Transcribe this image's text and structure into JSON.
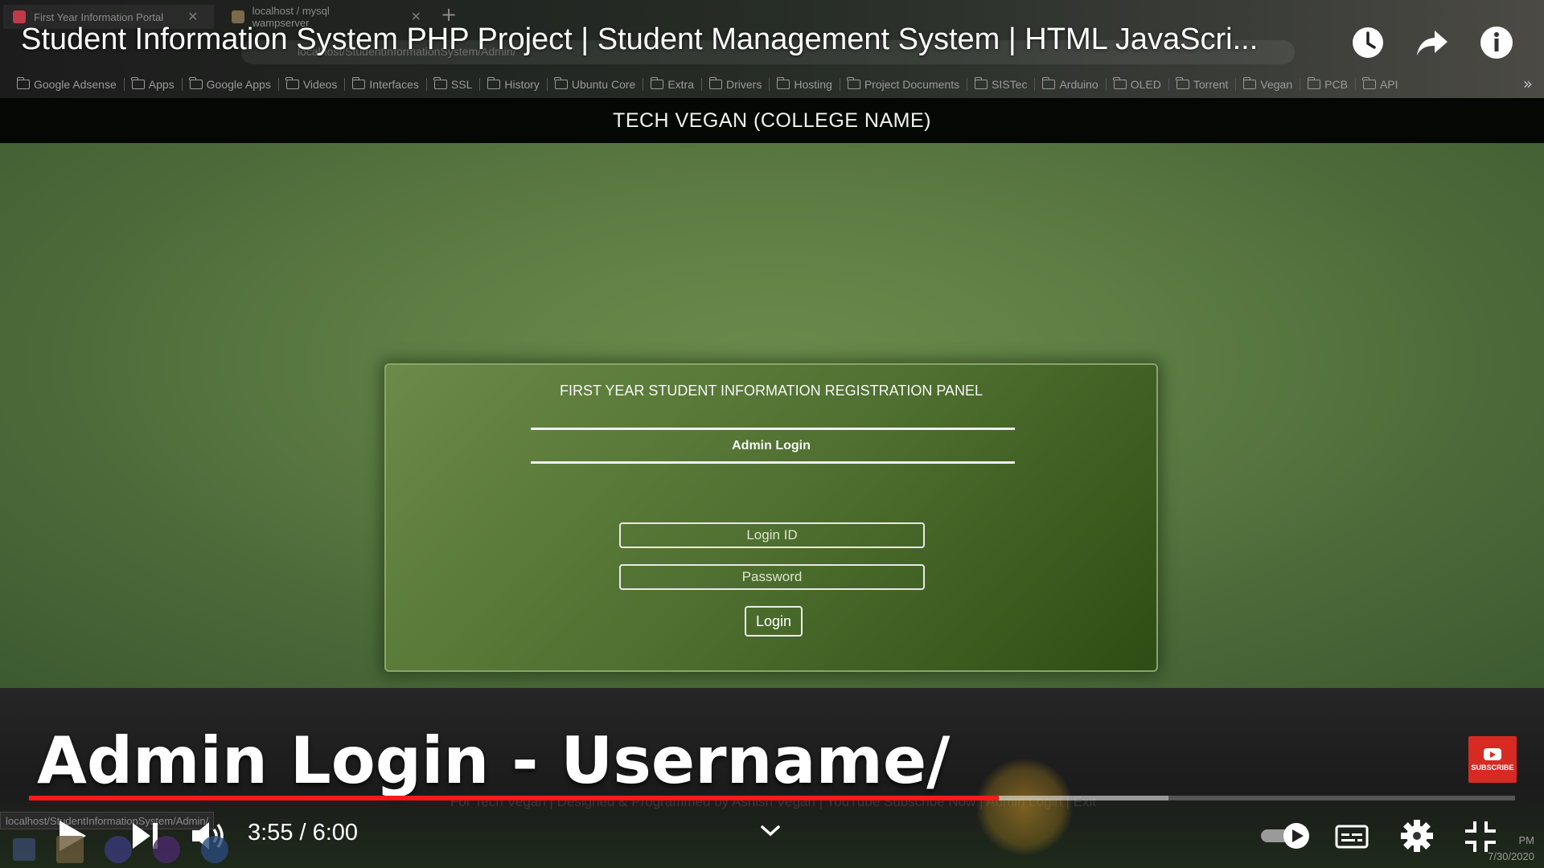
{
  "browser": {
    "tabs": [
      {
        "label": "First Year Information Portal",
        "favicon_color": "#c03a4a"
      },
      {
        "label": "localhost / mysql wampserver",
        "favicon_color": "#7a6a4a"
      }
    ],
    "new_tab_icon": "plus-icon",
    "address_bar_text": "localhost/StudentInformationSystem/Admin/",
    "bookmarks": [
      "Google Adsense",
      "Apps",
      "Google Apps",
      "Videos",
      "Interfaces",
      "SSL",
      "History",
      "Ubuntu Core",
      "Extra",
      "Drivers",
      "Hosting",
      "Project Documents",
      "SISTec",
      "Arduino",
      "OLED",
      "Torrent",
      "Vegan",
      "PCB",
      "API"
    ],
    "bookmarks_overflow": "»",
    "status_url": "localhost/StudentInformationSystem/Admin/"
  },
  "video": {
    "title": "Student Information System PHP Project | Student Management System | HTML JavaScri...",
    "top_actions": [
      "watch-later-icon",
      "share-icon",
      "info-icon"
    ],
    "caption": "Admin Login - Username/",
    "subscribe_label": "SUBSCRIBE",
    "time_current": "3:55",
    "time_total": "6:00",
    "time_display": "3:55 / 6:00",
    "progress_played_fraction": 0.6528,
    "progress_buffered_fraction": 0.7667,
    "accent_color": "#ff1a1a"
  },
  "site": {
    "header_title": "TECH VEGAN (COLLEGE NAME)",
    "panel_heading": "FIRST YEAR STUDENT INFORMATION REGISTRATION PANEL",
    "section_label": "Admin Login",
    "login_id_placeholder": "Login ID",
    "password_placeholder": "Password",
    "login_button": "Login",
    "footer_credit": "For Tech Vegan | Designed & Programmed by Ashish Vegan | YouTube Subscribe Now | Admin Login | Exit",
    "theme_color": "#4f7030"
  },
  "system": {
    "clock_time": "PM",
    "clock_date": "7/30/2020"
  }
}
